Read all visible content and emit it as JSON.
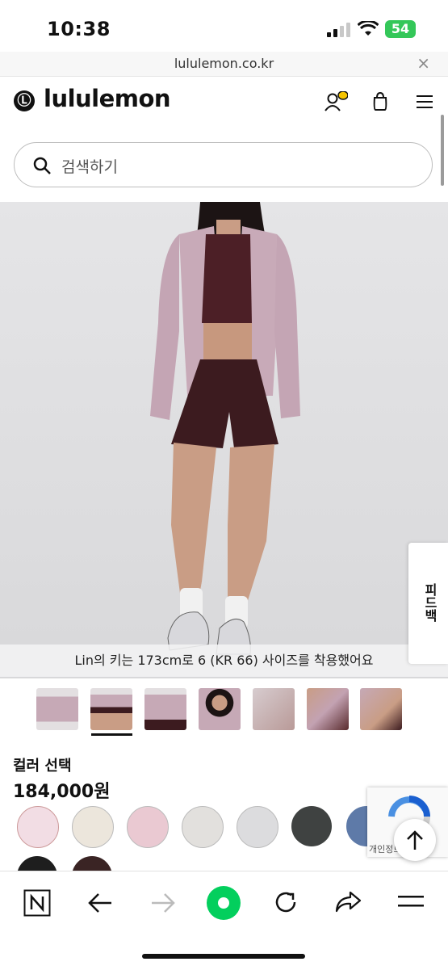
{
  "status_bar": {
    "time": "10:38",
    "battery": "54"
  },
  "browser": {
    "url": "lululemon.co.kr",
    "close_glyph": "×"
  },
  "header": {
    "logo_mark": "Ⓛ",
    "brand": "lululemon",
    "icons": [
      "account-icon",
      "bag-icon",
      "menu-icon"
    ]
  },
  "search": {
    "placeholder": "검색하기"
  },
  "product": {
    "image_caption": "Lin의 키는 173cm로 6 (KR 66) 사이즈를 착용했어요",
    "side_tab_label": "피드백",
    "color_label": "컬러 선택",
    "price": "184,000원",
    "swatches": [
      "#f2dde4",
      "#ece6dc",
      "#eac9d2",
      "#e2e0dd",
      "#dcdcde",
      "#3f4241",
      "#5e7aa8",
      "#1e1e1e",
      "#3a2424"
    ]
  },
  "recaptcha": {
    "footer_text": "개인정보 - 약관"
  },
  "toolbar": {
    "items": [
      "naver-n-icon",
      "back-icon",
      "forward-icon",
      "green-dot-icon",
      "reload-icon",
      "share-icon",
      "menu-icon"
    ]
  }
}
